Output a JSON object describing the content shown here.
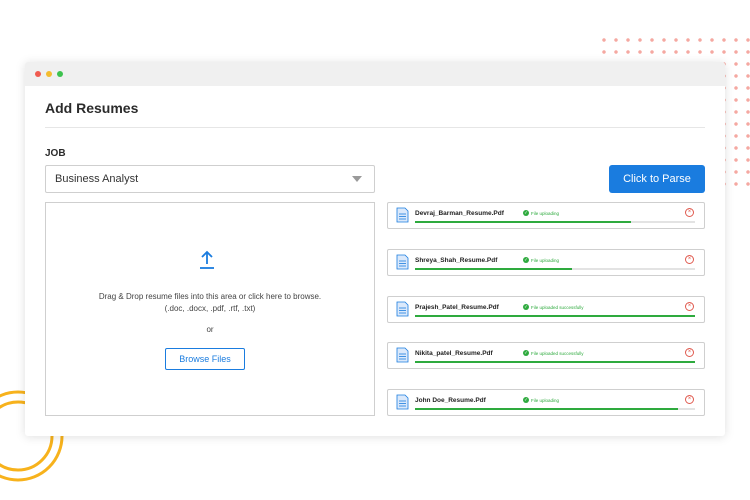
{
  "app": {
    "title": "Add Resumes",
    "job_label": "JOB",
    "job_selected": "Business Analyst",
    "parse_button": "Click to Parse",
    "dropzone": {
      "line1": "Drag & Drop resume files into this area or click here to browse.",
      "line2": "(.doc, .docx, .pdf, .rtf, .txt)",
      "or": "or",
      "browse_button": "Browse Files"
    },
    "files": [
      {
        "name": "Devraj_Barman_Resume.Pdf",
        "status": "File uploading",
        "progress": 0.77
      },
      {
        "name": "Shreya_Shah_Resume.Pdf",
        "status": "File uploading",
        "progress": 0.56
      },
      {
        "name": "Prajesh_Patel_Resume.Pdf",
        "status": "File uploaded successfully",
        "progress": 1.0
      },
      {
        "name": "Nikita_patel_Resume.Pdf",
        "status": "File uploaded successfully",
        "progress": 1.0
      },
      {
        "name": "John Doe_Resume.Pdf",
        "status": "File uploading",
        "progress": 0.94
      }
    ]
  },
  "colors": {
    "accent": "#1a7cdf",
    "success": "#2eaa3e",
    "error": "#e05a4f",
    "window_dots": [
      "#f05b50",
      "#f4bc2f",
      "#3dc24e"
    ],
    "decor_dots": "#f4a39c",
    "decor_rings": "#f7b21c"
  },
  "icons": {
    "upload": "upload-arrow-icon",
    "file": "document-icon",
    "status": "check-circle-icon",
    "remove": "close-circle-icon",
    "select": "chevron-down-icon"
  }
}
